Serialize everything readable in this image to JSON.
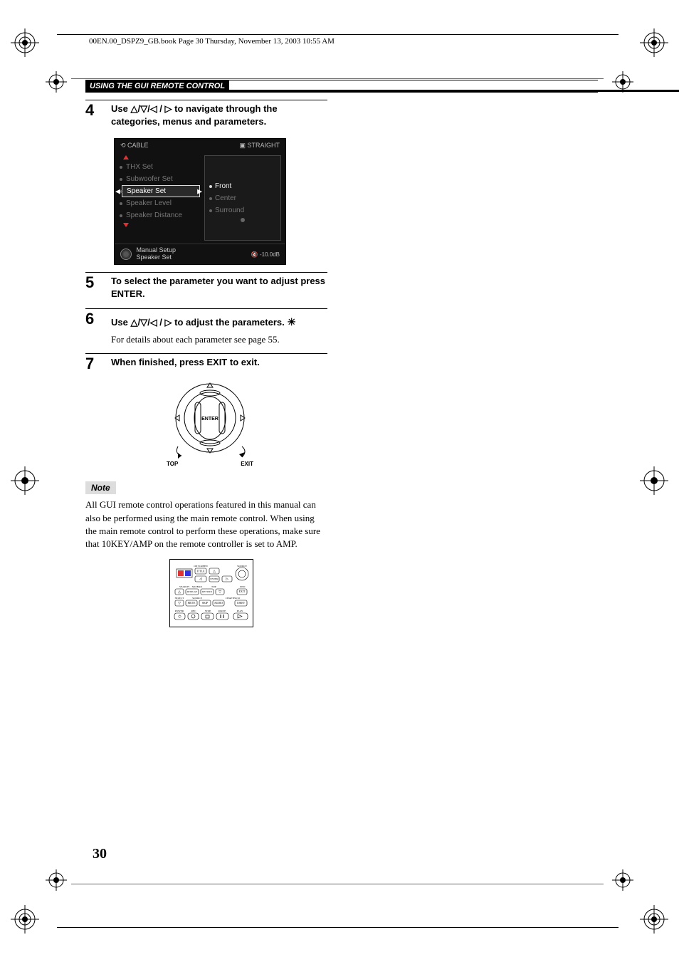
{
  "header": "00EN.00_DSPZ9_GB.book  Page 30  Thursday, November 13, 2003  10:55 AM",
  "section_title": "USING THE GUI REMOTE CONTROL",
  "steps": {
    "s4": {
      "num": "4",
      "text_a": "Use ",
      "text_b": " to navigate through the categories, menus and parameters."
    },
    "s5": {
      "num": "5",
      "text": "To select the parameter you want to adjust press ENTER."
    },
    "s6": {
      "num": "6",
      "text_a": "Use ",
      "text_b": " to adjust the parameters.",
      "tip": "For details about each parameter see page 55."
    },
    "s7": {
      "num": "7",
      "text": "When finished, press EXIT to exit."
    }
  },
  "gui": {
    "top_left": "CABLE",
    "top_right": "STRAIGHT",
    "left_items": [
      "THX Set",
      "Subwoofer Set",
      "Speaker Set",
      "Speaker Level",
      "Speaker Distance"
    ],
    "right_items": [
      "Front",
      "Center",
      "Surround"
    ],
    "bottom_left_1": "Manual Setup",
    "bottom_left_2": "Speaker Set",
    "bottom_right": "-10.0dB"
  },
  "dpad": {
    "center": "ENTER",
    "bl": "TOP",
    "br": "EXIT"
  },
  "note": {
    "label": "Note",
    "text": "All GUI remote control operations featured in this manual can also be performed using the main remote control. When using the main remote control to perform these operations, make sure that 10KEY/AMP on the remote controller is set to AMP."
  },
  "remote_labels": {
    "t1": "ON SCREEN",
    "t2": "TITLE",
    "t3": "SOURCE",
    "r1": "ENTER",
    "r2": "CH",
    "row1": [
      "SEARCH",
      "MO/BAR",
      "TOP",
      "DISC"
    ],
    "b1": "DISPLAY",
    "b2": "RETURN",
    "b3": "EXIT",
    "row2": [
      "SELECT",
      "SOURCE",
      "CHAPTER/10"
    ],
    "b4": "MUTE",
    "b5": "SKIP",
    "b6": "AUDIO",
    "b7": "10KEY",
    "row3": [
      "POWER",
      "REC",
      "STOP",
      "PAUSE",
      "PLAY"
    ]
  },
  "page_number": "30"
}
